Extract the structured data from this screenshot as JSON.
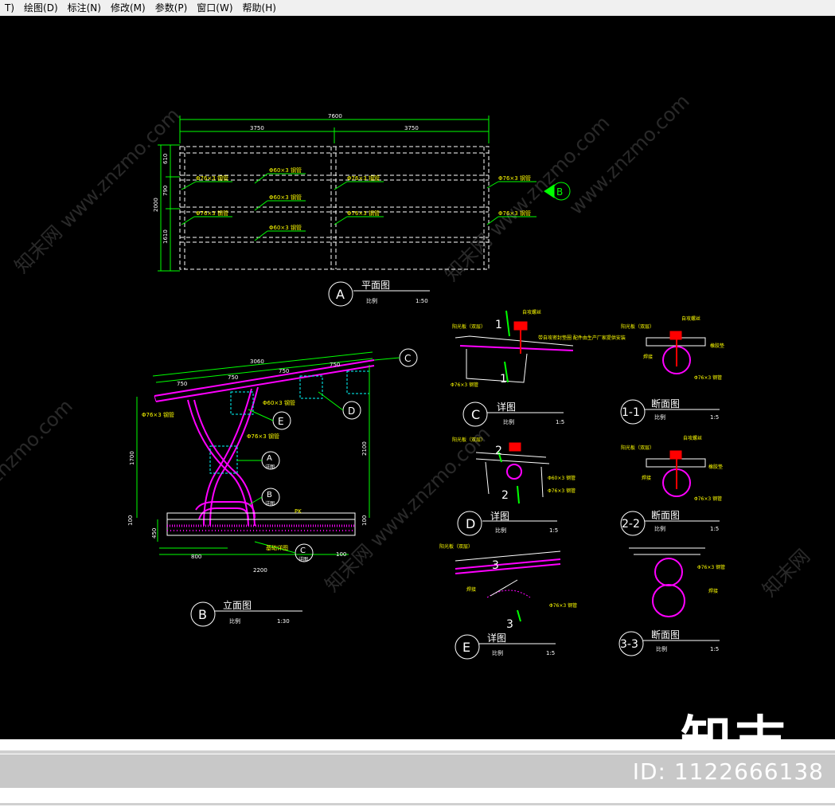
{
  "menu": [
    "T)",
    "绘图(D)",
    "标注(N)",
    "修改(M)",
    "参数(P)",
    "窗口(W)",
    "帮助(H)"
  ],
  "watermarks": [
    "知末网 www.znzmo.com",
    "知末网 www.znzmo.com",
    "知末网 www.znzmo.com",
    "www.znzmo.com",
    "znzmo.com",
    "知末网"
  ],
  "brand": "知末",
  "image_id": "ID: 1122666138",
  "plan": {
    "dims": {
      "total": "7600",
      "left": "3750",
      "right": "3750",
      "side_total": "2000",
      "d1": "610",
      "d2": "790",
      "d3": "1610"
    },
    "labels": {
      "pipe76_a": "Φ76×3 钢管",
      "pipe60_a": "Φ60×3 钢管",
      "pipe76_b": "Φ76×3 钢管",
      "pipe60_b": "Φ60×3 钢管",
      "pipe76_c": "Φ76×3 钢管",
      "pipe60_c": "Φ60×3 钢管",
      "pipe76_d": "Φ76×3 钢管",
      "pipe76_e": "Φ76×3 钢管",
      "pipe76_f": "Φ76×3 钢管"
    },
    "title_mark": "A",
    "title": "平面图",
    "scale_label": "比例",
    "scale": "1:50",
    "section_mark": "B"
  },
  "elevation": {
    "dims": {
      "top": "3060",
      "s1": "750",
      "s2": "750",
      "s3": "750",
      "s4": "750",
      "height": "1700",
      "height2": "2100",
      "base1": "100",
      "base2": "450",
      "base3": "100",
      "foot": "800",
      "width": "2200",
      "foot2": "100"
    },
    "labels": {
      "pipe76": "Φ76×3 钢管",
      "pipe60": "Φ60×3 钢管",
      "pipe76b": "Φ76×3 钢管",
      "basin": "基础详图",
      "arrow": "PK"
    },
    "callouts": [
      "C",
      "D",
      "E",
      "A",
      "B",
      "C"
    ],
    "callout_sub": [
      "详图",
      "详图",
      "详图"
    ],
    "title_mark": "B",
    "title": "立面图",
    "scale_label": "比例",
    "scale": "1:30"
  },
  "details": [
    {
      "mark": "C",
      "title": "详图",
      "scale_label": "比例",
      "scale": "1:5",
      "notes": [
        "阳光板（双层）",
        "自攻螺丝",
        "带自攻密封垫圈 配件由生产厂家提供安装",
        "Φ76×3 钢管"
      ],
      "cuts": [
        "1",
        "1"
      ]
    },
    {
      "mark": "D",
      "title": "详图",
      "scale_label": "比例",
      "scale": "1:5",
      "notes": [
        "阳光板（双层）",
        "Φ60×3 钢管",
        "Φ76×3 钢管"
      ],
      "cuts": [
        "2",
        "2"
      ]
    },
    {
      "mark": "E",
      "title": "详图",
      "scale_label": "比例",
      "scale": "1:5",
      "notes": [
        "阳光板（双层）",
        "焊接",
        "Φ76×3 钢管"
      ],
      "cuts": [
        "3",
        "3"
      ]
    },
    {
      "mark": "1-1",
      "title": "断面图",
      "scale_label": "比例",
      "scale": "1:5",
      "notes": [
        "阳光板（双层）",
        "自攻螺丝",
        "橡胶垫",
        "焊接",
        "Φ76×3 钢管"
      ]
    },
    {
      "mark": "2-2",
      "title": "断面图",
      "scale_label": "比例",
      "scale": "1:5",
      "notes": [
        "阳光板（双层）",
        "自攻螺丝",
        "橡胶垫",
        "焊接",
        "Φ76×3 钢管"
      ]
    },
    {
      "mark": "3-3",
      "title": "断面图",
      "scale_label": "比例",
      "scale": "1:5",
      "notes": [
        "Φ76×3 钢管",
        "焊接"
      ]
    }
  ],
  "colors": {
    "line": "#ffffff",
    "dim": "#00ff00",
    "pipe": "#ff00ff",
    "note": "#ffff00",
    "canvas": "#000000"
  }
}
